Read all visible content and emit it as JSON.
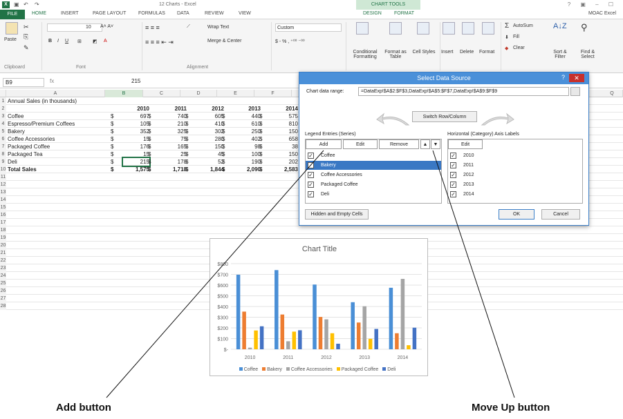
{
  "titlebar": {
    "window_title": "12 Charts - Excel",
    "chart_tools": "CHART TOOLS",
    "window_controls": "? ▣ – ☐"
  },
  "tabs": [
    "FILE",
    "HOME",
    "INSERT",
    "PAGE LAYOUT",
    "FORMULAS",
    "DATA",
    "REVIEW",
    "VIEW",
    "DESIGN",
    "FORMAT"
  ],
  "account": "MOAC Excel",
  "ribbon": {
    "paste": "Paste",
    "clipboard": "Clipboard",
    "font_group": "Font",
    "font_size": "10",
    "alignment_group": "Alignment",
    "wrap_text": "Wrap Text",
    "merge_center": "Merge & Center",
    "number_format": "Custom",
    "conditional_formatting": "Conditional Formatting",
    "format_as_table": "Format as Table",
    "cell_styles": "Cell Styles",
    "insert": "Insert",
    "delete": "Delete",
    "format": "Format",
    "autosum": "AutoSum",
    "fill": "Fill",
    "clear": "Clear",
    "sort_filter": "Sort & Filter",
    "find_select": "Find & Select"
  },
  "formula_bar": {
    "name_box": "B9",
    "fx": "fx",
    "value": "215"
  },
  "columns": [
    "A",
    "B",
    "C",
    "D",
    "E",
    "F",
    "Q"
  ],
  "rows": [
    {
      "n": "1",
      "a": "Annual Sales (in thousands)",
      "v": []
    },
    {
      "n": "2",
      "a": "",
      "v": [
        "2010",
        "2011",
        "2012",
        "2013",
        "2014"
      ]
    },
    {
      "n": "3",
      "a": "Coffee",
      "v": [
        "697",
        "740",
        "605",
        "440",
        "575"
      ]
    },
    {
      "n": "4",
      "a": "Espresso/Premium Coffees",
      "v": [
        "105",
        "210",
        "410",
        "610",
        "810"
      ]
    },
    {
      "n": "5",
      "a": "Bakery",
      "v": [
        "352",
        "325",
        "302",
        "250",
        "150"
      ]
    },
    {
      "n": "6",
      "a": "Coffee Accessories",
      "v": [
        "15",
        "75",
        "280",
        "402",
        "658"
      ]
    },
    {
      "n": "7",
      "a": "Packaged Coffee",
      "v": [
        "176",
        "165",
        "150",
        "98",
        "38"
      ]
    },
    {
      "n": "8",
      "a": "Packaged Tea",
      "v": [
        "15",
        "25",
        "45",
        "100",
        "150"
      ]
    },
    {
      "n": "9",
      "a": "Deli",
      "v": [
        "215",
        "178",
        "52",
        "190",
        "202"
      ]
    },
    {
      "n": "10",
      "a": "Total Sales",
      "v": [
        "1,575",
        "1,718",
        "1,844",
        "2,090",
        "2,583"
      ]
    }
  ],
  "dollar": "$",
  "empty_rows": [
    "11",
    "12",
    "13",
    "14",
    "15",
    "16",
    "17",
    "18",
    "19",
    "20",
    "21",
    "22",
    "23",
    "24",
    "25",
    "26",
    "27",
    "28"
  ],
  "dialog": {
    "title": "Select Data Source",
    "help": "?",
    "close": "✕",
    "range_label": "Chart data range:",
    "range_value": "=DataExp!$A$2:$F$3,DataExp!$A$5:$F$7,DataExp!$A$9:$F$9",
    "switch": "Switch Row/Column",
    "legend_label": "Legend Entries (Series)",
    "axis_label": "Horizontal (Category) Axis Labels",
    "add": "Add",
    "edit": "Edit",
    "remove": "Remove",
    "axis_edit": "Edit",
    "series": [
      "Coffee",
      "Bakery",
      "Coffee Accessories",
      "Packaged Coffee",
      "Deli"
    ],
    "selected_series": "Bakery",
    "categories": [
      "2010",
      "2011",
      "2012",
      "2013",
      "2014"
    ],
    "hidden_cells": "Hidden and Empty Cells",
    "ok": "OK",
    "cancel": "Cancel"
  },
  "chart_data": {
    "type": "bar",
    "title": "Chart Title",
    "categories": [
      "2010",
      "2011",
      "2012",
      "2013",
      "2014"
    ],
    "y_ticks": [
      "$800",
      "$700",
      "$600",
      "$500",
      "$400",
      "$300",
      "$200",
      "$100",
      "$-"
    ],
    "ylim": [
      0,
      800
    ],
    "series": [
      {
        "name": "Coffee",
        "color": "#4a8fd6",
        "values": [
          697,
          740,
          605,
          440,
          575
        ]
      },
      {
        "name": "Bakery",
        "color": "#ed7d31",
        "values": [
          352,
          325,
          302,
          250,
          150
        ]
      },
      {
        "name": "Coffee Accessories",
        "color": "#a5a5a5",
        "values": [
          15,
          75,
          280,
          402,
          658
        ]
      },
      {
        "name": "Packaged Coffee",
        "color": "#ffc000",
        "values": [
          176,
          165,
          150,
          98,
          38
        ]
      },
      {
        "name": "Deli",
        "color": "#4472c4",
        "values": [
          215,
          178,
          52,
          190,
          202
        ]
      }
    ],
    "legend": "bottom"
  },
  "callouts": {
    "add": "Add button",
    "move_up": "Move Up button"
  }
}
